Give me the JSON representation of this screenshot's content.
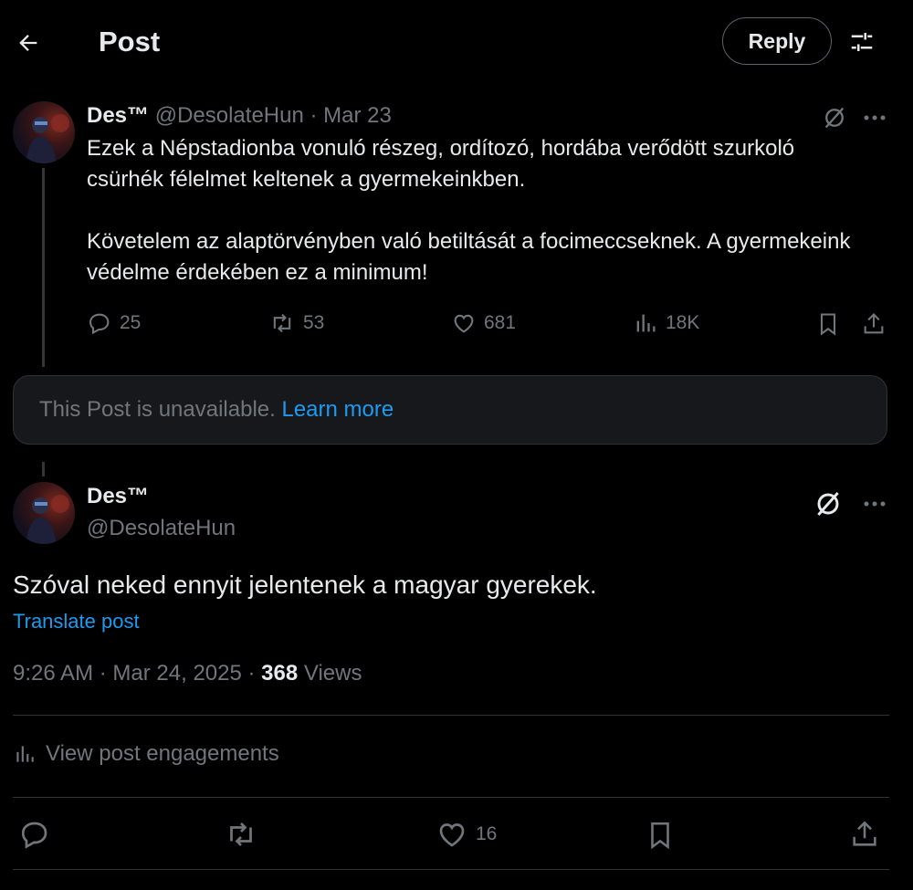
{
  "header": {
    "title": "Post",
    "reply_label": "Reply"
  },
  "original_post": {
    "display_name": "Des™",
    "handle": "@DesolateHun",
    "date": "Mar 23",
    "paragraphs": [
      "Ezek a Népstadionba vonuló részeg, ordítozó, hordába verődött szurkoló csürhék félelmet keltenek a gyermekeinkben.",
      "Követelem az alaptörvényben való betiltását a focimeccseknek. A gyermekeink védelme érdekében ez a minimum!"
    ],
    "stats": {
      "replies": "25",
      "reposts": "53",
      "likes": "681",
      "views": "18K"
    }
  },
  "unavailable": {
    "text": "This Post is unavailable.",
    "link": "Learn more"
  },
  "main_post": {
    "display_name": "Des™",
    "handle": "@DesolateHun",
    "text": "Szóval neked ennyit jelentenek a magyar gyerekek.",
    "translate": "Translate post",
    "time": "9:26 AM",
    "date": "Mar 24, 2025",
    "views_count": "368",
    "views_label": "Views",
    "engagements_label": "View post engagements",
    "stats": {
      "likes": "16"
    }
  },
  "theme": {
    "background": "#000000",
    "text": "#e7e9ea",
    "muted": "#71767b",
    "link": "#1d9bf0",
    "card": "#16181c"
  },
  "icons": [
    "back-arrow-icon",
    "settings-sliders-icon",
    "grok-icon",
    "more-icon",
    "reply-icon",
    "repost-icon",
    "like-icon",
    "views-icon",
    "bookmark-icon",
    "share-icon"
  ]
}
